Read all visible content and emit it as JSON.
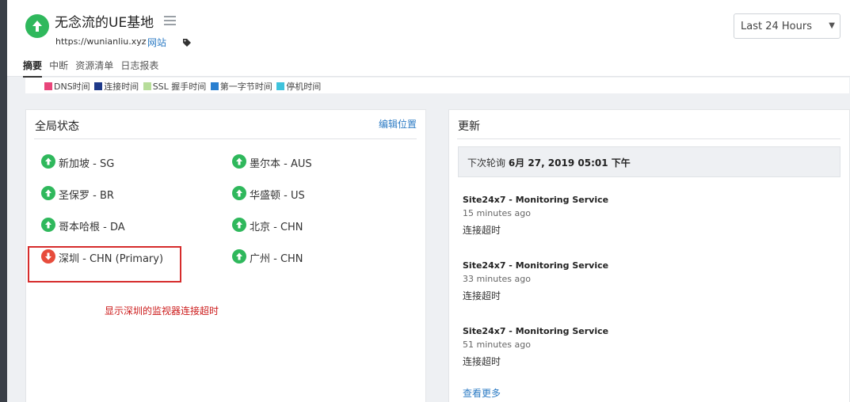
{
  "site": {
    "title": "无念流的UE基地",
    "url": "https://wunianliu.xyz",
    "link_label": "网站",
    "status": "up"
  },
  "period_select": {
    "value": "Last 24 Hours"
  },
  "tabs": [
    "摘要",
    "中断",
    "资源清单",
    "日志报表"
  ],
  "legend": [
    {
      "label": "DNS时间",
      "color": "#e8457a"
    },
    {
      "label": "连接时间",
      "color": "#1f3a8a"
    },
    {
      "label": "SSL 握手时间",
      "color": "#b7dd9a"
    },
    {
      "label": "第一字节时间",
      "color": "#2a7fd0"
    },
    {
      "label": "停机时间",
      "color": "#3fc3dc"
    }
  ],
  "global_status": {
    "title": "全局状态",
    "edit_label": "编辑位置",
    "locations": [
      {
        "label": "新加坡 - SG",
        "status": "up"
      },
      {
        "label": "墨尔本 - AUS",
        "status": "up"
      },
      {
        "label": "圣保罗 - BR",
        "status": "up"
      },
      {
        "label": "华盛顿 - US",
        "status": "up"
      },
      {
        "label": "哥本哈根 - DA",
        "status": "up"
      },
      {
        "label": "北京 - CHN",
        "status": "up"
      },
      {
        "label": "深圳 - CHN (Primary)",
        "status": "down"
      },
      {
        "label": "广州 - CHN",
        "status": "up"
      }
    ],
    "annotation": "显示深圳的监视器连接超时"
  },
  "updates": {
    "title": "更新",
    "next_poll_label": "下次轮询",
    "next_poll_time": "6月 27, 2019 05:01 下午",
    "items": [
      {
        "source": "Site24x7 - Monitoring Service",
        "time": "15 minutes ago",
        "message": "连接超时"
      },
      {
        "source": "Site24x7 - Monitoring Service",
        "time": "33 minutes ago",
        "message": "连接超时"
      },
      {
        "source": "Site24x7 - Monitoring Service",
        "time": "51 minutes ago",
        "message": "连接超时"
      }
    ],
    "more_label": "查看更多"
  },
  "colors": {
    "up": "#2fb85c",
    "down": "#e74c3c",
    "link": "#2c7bc4",
    "annotation": "#d62c2c"
  }
}
